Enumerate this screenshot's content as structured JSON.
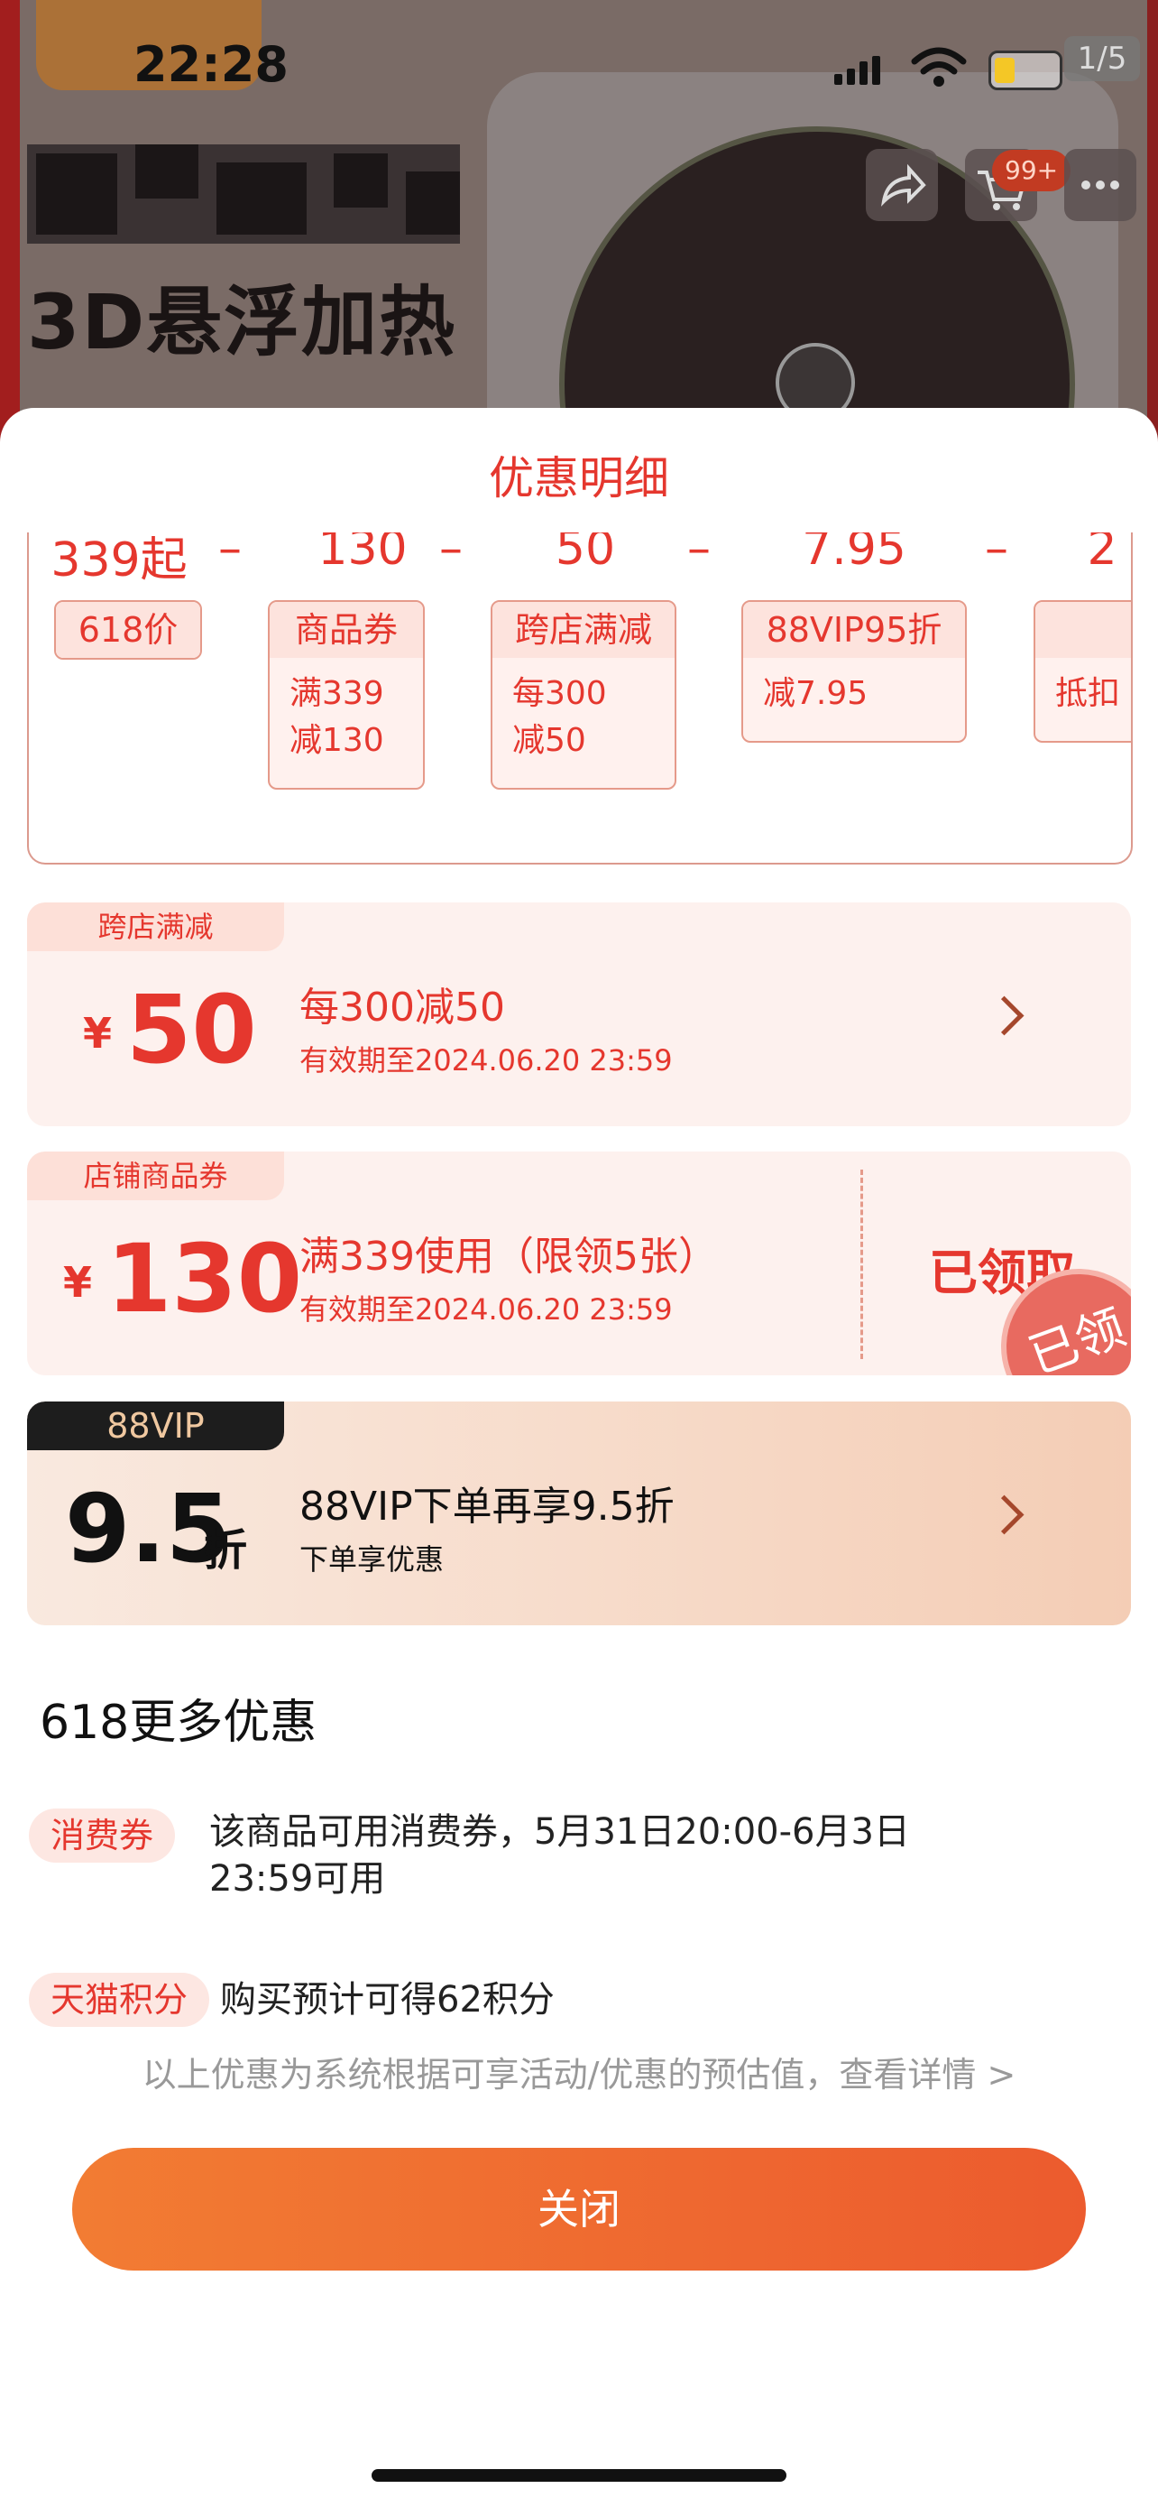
{
  "status_bar": {
    "time": "22:28",
    "page_indicator": "1/5"
  },
  "product_bg": {
    "headline": "3D悬浮加热",
    "cart_badge": "99+"
  },
  "sheet": {
    "title": "优惠明细"
  },
  "breakdown": {
    "amounts": [
      "339起",
      "130",
      "50",
      "7.95",
      "2"
    ],
    "items": [
      {
        "label": "618价"
      },
      {
        "label": "商品券",
        "detail": [
          "满339",
          "减130"
        ]
      },
      {
        "label": "跨店满减",
        "detail": [
          "每300",
          "减50"
        ]
      },
      {
        "label": "88VIP95折",
        "detail": [
          "减7.95"
        ]
      },
      {
        "label": "",
        "detail": [
          "抵扣"
        ]
      }
    ]
  },
  "coupons": [
    {
      "tag": "跨店满减",
      "symbol": "¥",
      "amount": "50",
      "line1": "每300减50",
      "line2": "有效期至2024.06.20 23:59"
    },
    {
      "tag": "店铺商品券",
      "symbol": "¥",
      "amount": "130",
      "line1": "满339使用（限领5张）",
      "line2": "有效期至2024.06.20 23:59",
      "status": "已领取",
      "stamp": "已领"
    }
  ],
  "vip": {
    "tag": "88VIP",
    "amount": "9.5",
    "unit": "折",
    "line1": "88VIP下单再享9.5折",
    "line2": "下单享优惠"
  },
  "more": {
    "title": "618更多优惠",
    "rows": [
      {
        "pill": "消费券",
        "text": "该商品可用消费券，5月31日20:00-6月3日23:59可用"
      },
      {
        "pill": "天猫积分",
        "text": "购买预计可得62积分"
      }
    ],
    "note": "以上优惠为系统根据可享活动/优惠的预估值，查看详情 >"
  },
  "close_label": "关闭",
  "colors": {
    "accent": "#e5372e",
    "button_start": "#f27c33",
    "button_end": "#ec5b2e"
  }
}
